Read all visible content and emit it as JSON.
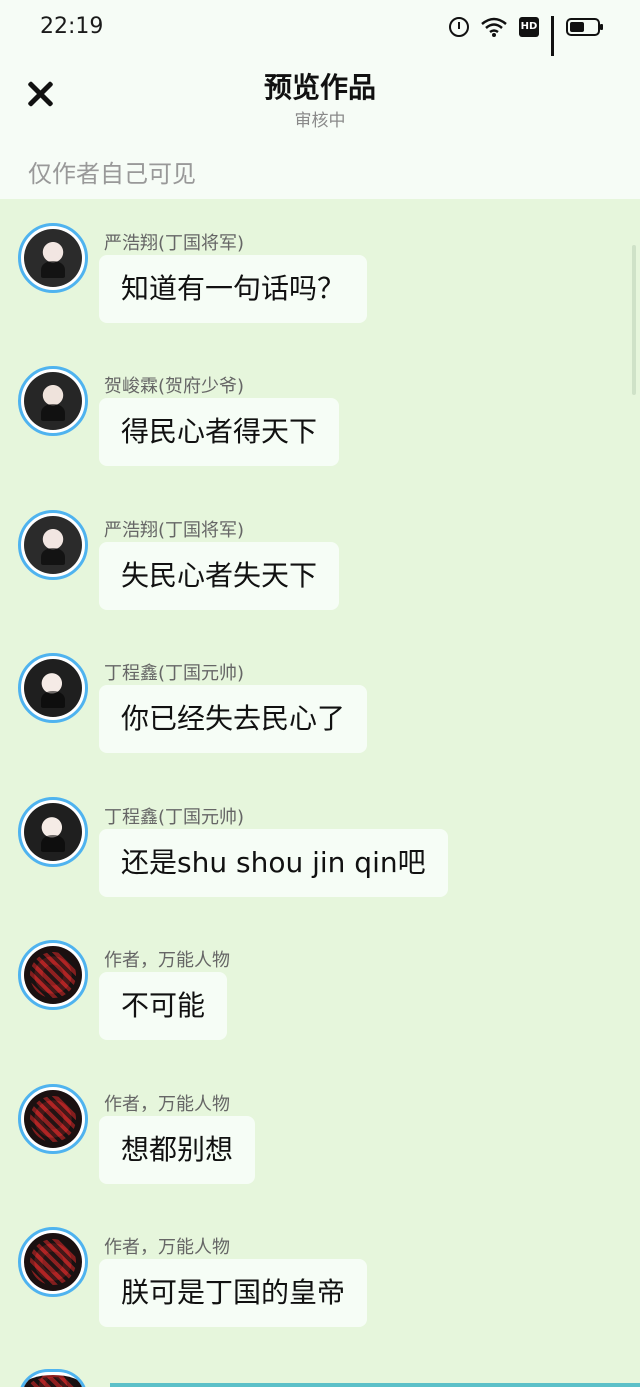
{
  "status_bar": {
    "time": "22:19",
    "icons": [
      "alarm-icon",
      "wifi-icon",
      "hd-icon",
      "signal-4g-icon",
      "battery-icon"
    ],
    "network_label": "4G",
    "hd_label": "HD"
  },
  "header": {
    "title": "预览作品",
    "subtitle": "审核中",
    "close_icon": "close-icon"
  },
  "visibility_note": "仅作者自己可见",
  "colors": {
    "chat_background": "#e6f6dc",
    "bubble_background": "#f6fdf6",
    "avatar_border": "#4fb3ef",
    "page_background": "#f6fcf6"
  },
  "messages": [
    {
      "sender": "严浩翔(丁国将军)",
      "text": "知道有一句话吗？"
    },
    {
      "sender": "贺峻霖(贺府少爷)",
      "text": "得民心者得天下"
    },
    {
      "sender": "严浩翔(丁国将军)",
      "text": "失民心者失天下"
    },
    {
      "sender": "丁程鑫(丁国元帅)",
      "text": "你已经失去民心了"
    },
    {
      "sender": "丁程鑫(丁国元帅)",
      "text": "还是shu shou jin qin吧"
    },
    {
      "sender": "作者，万能人物",
      "text": "不可能"
    },
    {
      "sender": "作者，万能人物",
      "text": "想都别想"
    },
    {
      "sender": "作者，万能人物",
      "text": "朕可是丁国的皇帝"
    }
  ]
}
